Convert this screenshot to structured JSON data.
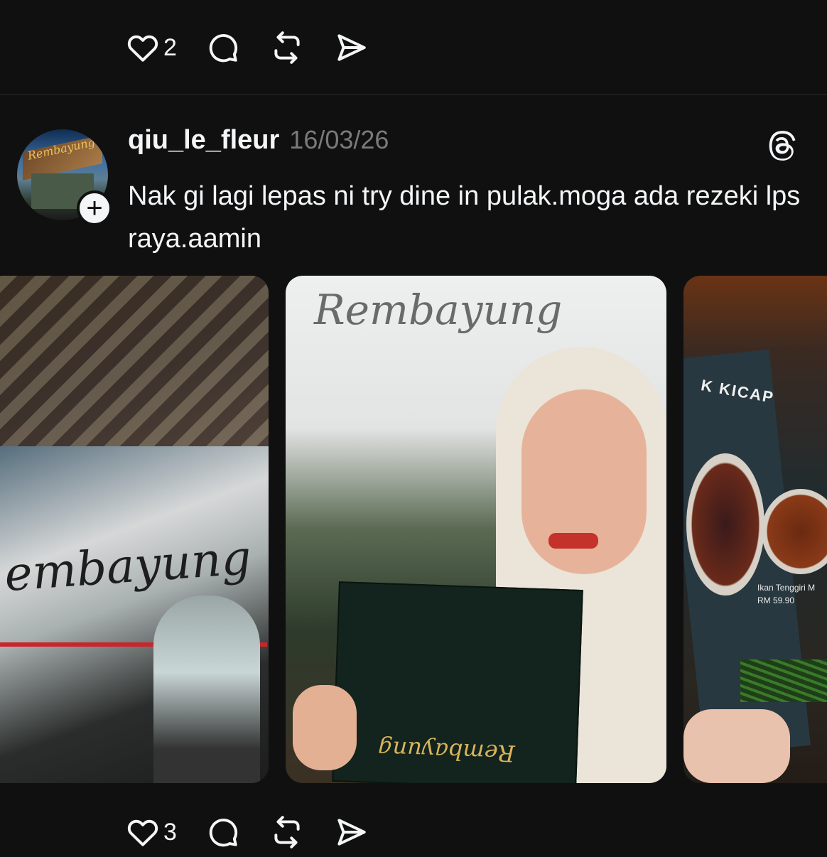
{
  "previous_post": {
    "actions": {
      "like_count": "2"
    }
  },
  "post": {
    "username": "qiu_le_fleur",
    "timestamp": "16/03/26",
    "text": "Nak gi lagi lepas ni try dine in pulak.moga ada rezeki lps raya.aamin",
    "photos": [
      {
        "name": "restaurant-exterior-selfie-photo",
        "sign_text": "embayung"
      },
      {
        "name": "woman-holding-menu-photo",
        "sign_text": "Rembayung"
      },
      {
        "name": "menu-page-photo",
        "title_text": "K KICAP",
        "caption_text": "Ikan Tenggiri M",
        "price_text": "RM 59.90"
      }
    ],
    "actions": {
      "like_count": "3"
    }
  },
  "icons": {
    "like": "heart-icon",
    "reply": "comment-bubble-icon",
    "repost": "repost-icon",
    "share": "send-icon",
    "app": "threads-icon",
    "follow": "plus-icon"
  },
  "colors": {
    "background": "#101010",
    "text": "#f3f5f7",
    "muted": "#7a7a7a",
    "divider": "#2a2a2a"
  }
}
